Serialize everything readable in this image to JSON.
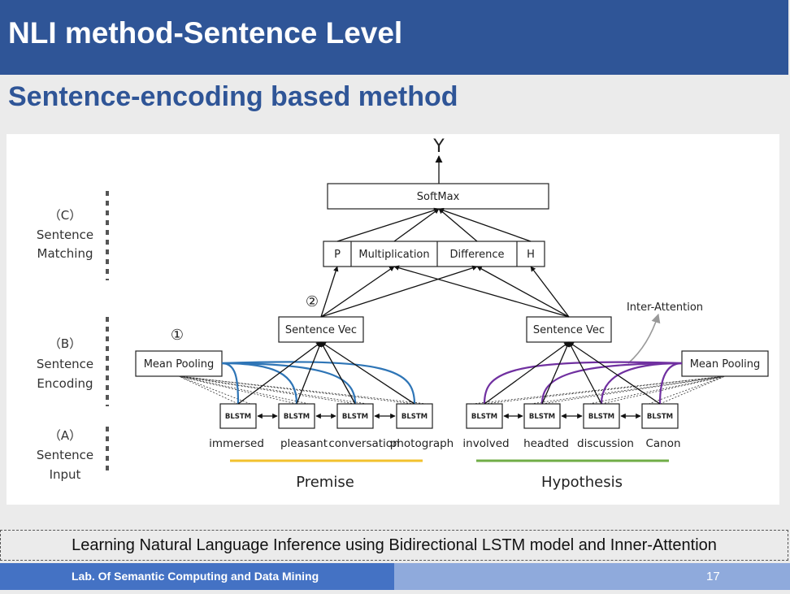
{
  "slide": {
    "title": "NLI method-Sentence Level",
    "subtitle": "Sentence-encoding based method",
    "caption": "Learning Natural Language Inference using Bidirectional LSTM model and Inner-Attention",
    "footer_lab": "Lab. Of Semantic Computing and Data Mining",
    "page_number": "17"
  },
  "diagram": {
    "output": "Y",
    "softmax": "SoftMax",
    "features": [
      "P",
      "Multiplication",
      "Difference",
      "H"
    ],
    "circle_1": "①",
    "circle_2": "②",
    "premise_vec": "Sentence Vec",
    "hypothesis_vec": "Sentence Vec",
    "mean_pooling_left": "Mean Pooling",
    "mean_pooling_right": "Mean Pooling",
    "inter_attention": "Inter-Attention",
    "blstm": "BLSTM",
    "premise_words": [
      "immersed",
      "pleasant",
      "conversation",
      "photograph"
    ],
    "hypothesis_words": [
      "involved",
      "headted",
      "discussion",
      "Canon"
    ],
    "premise_label": "Premise",
    "hypothesis_label": "Hypothesis",
    "levels": {
      "c": [
        "（C）",
        "Sentence",
        "Matching"
      ],
      "b": [
        "（B）",
        "Sentence",
        "Encoding"
      ],
      "a": [
        "（A）",
        "Sentence",
        "Input"
      ]
    },
    "colors": {
      "title_bar": "#2f5597",
      "premise_curves": "#2e75b6",
      "hypothesis_curves": "#7030a0",
      "premise_underline": "#f2c12e",
      "hypothesis_underline": "#70ad47"
    }
  }
}
